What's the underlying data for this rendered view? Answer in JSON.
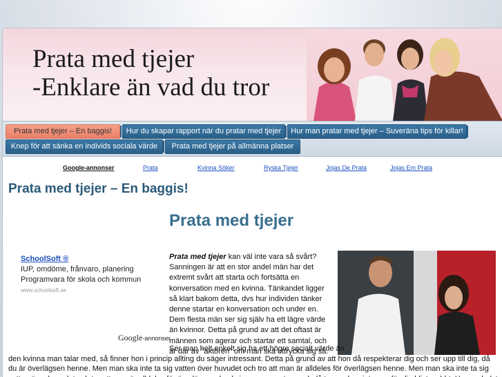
{
  "header": {
    "title_line1": "Prata med tjejer",
    "title_line2": "-Enklare än vad du tror"
  },
  "nav": {
    "tabs": [
      "Prata med tjejer – En baggis!",
      "Hur du skapar rapport när du pratar med tjejer",
      "Hur man pratar med tjejer – Suveräna tips för killar!",
      "Knep för att sänka en individs sociala värde",
      "Prata med tjejer på allmänna platser"
    ]
  },
  "ads_bar": {
    "label": "Google-annonser",
    "links": [
      "Prata",
      "Kvinna Söker",
      "Ryska Tjejer",
      "Jojas De Prata",
      "Jojas Em Prata"
    ]
  },
  "main": {
    "heading": "Prata med tjejer – En baggis!",
    "subheading": "Prata med tjejer",
    "intro_bold": "Prata med tjejer",
    "intro_rest": " kan väl inte vara så svårt? Sanningen är att en stor andel män har det extremt svårt att starta och fortsätta en konversation med en kvinna. Tänkandet ligger så klart bakom detta, dvs hur individen tänker denne startar en konversation och under en. Dem flesta män ser sig själv ha ett lägre värde än kvinnor. Detta på grund av att det oftast är männen som agerar och startar ett samtal, och är där av \"aktören\" om man ska uttrycka sig så.",
    "para2_first": "Ser man helt enkelt sig ha ett högre socialt värde än",
    "para2_rest": "den kvinna man talar med, så finner hon i princip allting du säger intressant. Detta på grund av att hon då respekterar dig och ser upp till dig, då du är överlägsen henne. Men man ska inte ta sig vatten över huvudet och tro att man är alldeles för överlägsen henne. Men man ska inte ta sig vatten över huvudet och tro att man är alldeles för överlägsen den kvinna man pratar med, då tappar hon intresse för dig blixtsnabbt. Hursomhelst, så finns det ett antal knep man kan använda sig utav för att snabbt och enkelt"
  },
  "ad": {
    "title": "SchoolSoft ®",
    "line1": "IUP, omdöme, frånvaro, planering",
    "line2": "Programvara för skola och kommun",
    "url": "www.schoolsoft.se",
    "google_text": "Google",
    "google_suffix": "-annonser"
  },
  "colors": {
    "nav_tab": "#2a5f88",
    "active_tab": "#e97f66",
    "heading": "#2b5a7a"
  }
}
